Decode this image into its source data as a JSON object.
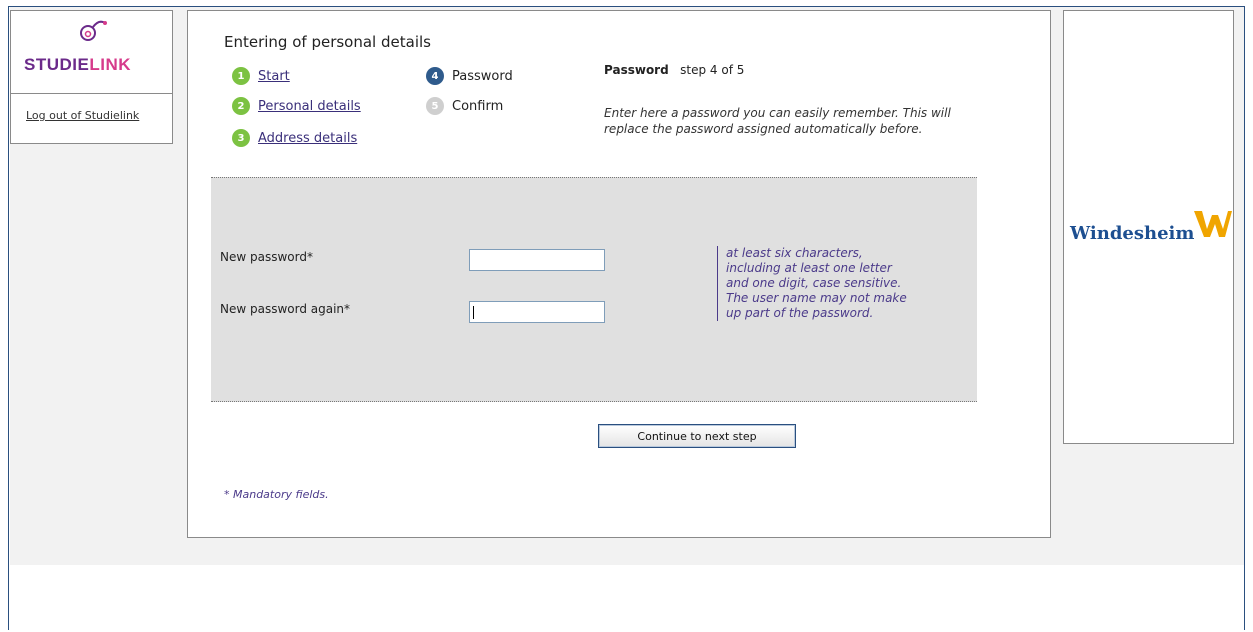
{
  "sidebar": {
    "logo_text_part1": "STUDIE",
    "logo_text_part2": "LINK",
    "logout_label": "Log out of Studielink"
  },
  "main": {
    "title": "Entering of personal details",
    "steps": [
      {
        "number": "1",
        "label": "Start",
        "state": "done"
      },
      {
        "number": "2",
        "label": "Personal details",
        "state": "done"
      },
      {
        "number": "3",
        "label": "Address details",
        "state": "done"
      },
      {
        "number": "4",
        "label": "Password",
        "state": "current"
      },
      {
        "number": "5",
        "label": "Confirm",
        "state": "todo"
      }
    ],
    "info_title": "Password",
    "info_step": "step 4 of 5",
    "info_text": "Enter here a password you can easily remember. This will replace the password assigned automatically before.",
    "form": {
      "new_password_label": "New password*",
      "new_password_value": "",
      "new_password_again_label": "New password again*",
      "new_password_again_value": "",
      "hint": "at least six characters, including at least one letter and one digit, case sensitive. The user name may not make up part of the password."
    },
    "continue_label": "Continue to next step",
    "mandatory_note": "* Mandatory fields."
  },
  "brand": {
    "partner_name": "Windesheim"
  },
  "colors": {
    "step_done": "#7cc242",
    "step_current": "#2f5b8c",
    "step_todo": "#cfcfcf",
    "link": "#3a2f7a",
    "hint": "#4b3a8a",
    "frame_border": "#2a4f7f"
  }
}
